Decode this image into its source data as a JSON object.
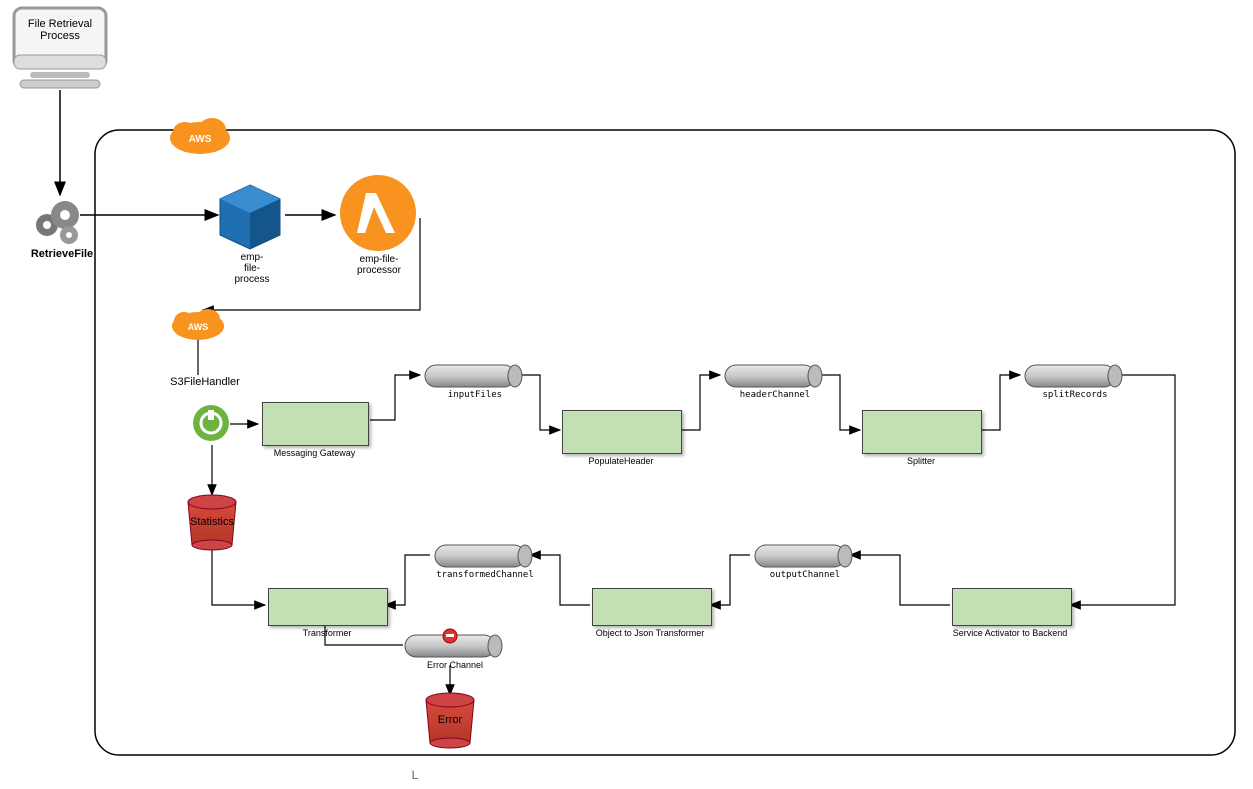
{
  "computer": {
    "title": "File Retrieval Process"
  },
  "retrieve": {
    "label": "RetrieveFile"
  },
  "aws_top": {
    "label": "AWS"
  },
  "aws_mid": {
    "label": "AWS"
  },
  "s3bucket": {
    "label": "emp-\nfile-\nprocess"
  },
  "lambda": {
    "label": "emp-file-\nprocessor"
  },
  "s3filehandler": {
    "label": "S3FileHandler"
  },
  "gateway": {
    "label": "Messaging Gateway"
  },
  "statistics": {
    "label": "Statistics"
  },
  "channel1": {
    "label": "inputFiles"
  },
  "populate": {
    "label": "PopulateHeader"
  },
  "channel2": {
    "label": "headerChannel"
  },
  "splitter": {
    "label": "Splitter"
  },
  "channel3": {
    "label": "splitRecords"
  },
  "service": {
    "label": "Service Activator to Backend"
  },
  "channel4": {
    "label": "outputChannel"
  },
  "o2j": {
    "label": "Object to Json Transformer"
  },
  "channel5": {
    "label": "transformedChannel"
  },
  "transformer": {
    "label": "Transformer"
  },
  "errchannel": {
    "label": "Error Channel"
  },
  "errbucket": {
    "label": "Error"
  },
  "footer": {
    "label": "L"
  }
}
